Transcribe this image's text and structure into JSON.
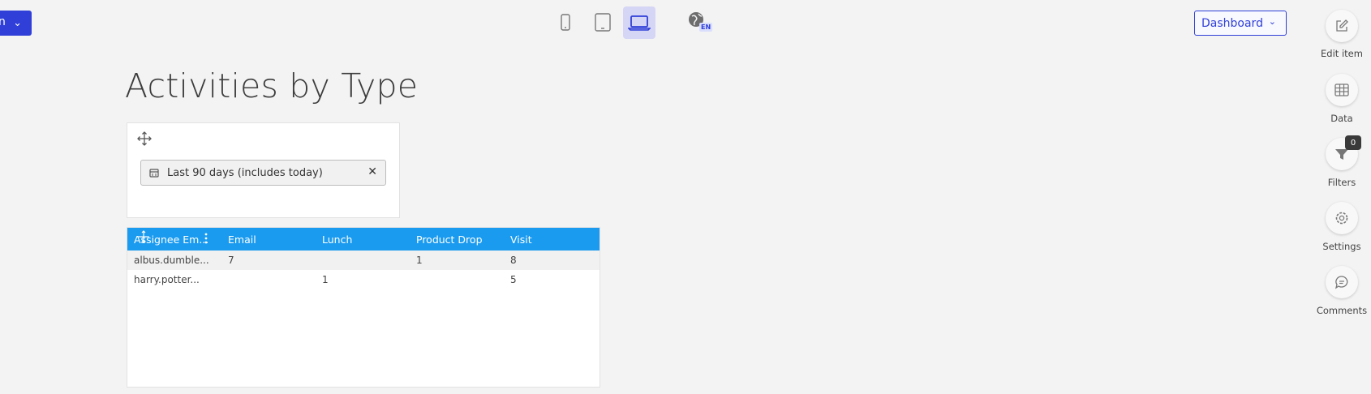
{
  "toolbar": {
    "left_button_label": "n",
    "dashboard_select_value": "Dashboard",
    "language_code": "EN"
  },
  "page": {
    "title": "Activities by Type"
  },
  "filter": {
    "date_range_value": "Last 90 days (includes today)"
  },
  "table": {
    "columns": [
      "Assignee Em...",
      "Email",
      "Lunch",
      "Product Drop",
      "Visit"
    ],
    "rows": [
      {
        "assignee": "albus.dumble...",
        "email": "7",
        "lunch": "",
        "product_drop": "1",
        "visit": "8"
      },
      {
        "assignee": "harry.potter...",
        "email": "",
        "lunch": "1",
        "product_drop": "",
        "visit": "5"
      }
    ]
  },
  "rail": {
    "edit_item": "Edit item",
    "data": "Data",
    "filters": "Filters",
    "filters_count": "0",
    "settings": "Settings",
    "comments": "Comments"
  },
  "colors": {
    "primary": "#2f3fd8",
    "table_header": "#1a9bf0",
    "active_device_bg": "#d5d5f5"
  }
}
